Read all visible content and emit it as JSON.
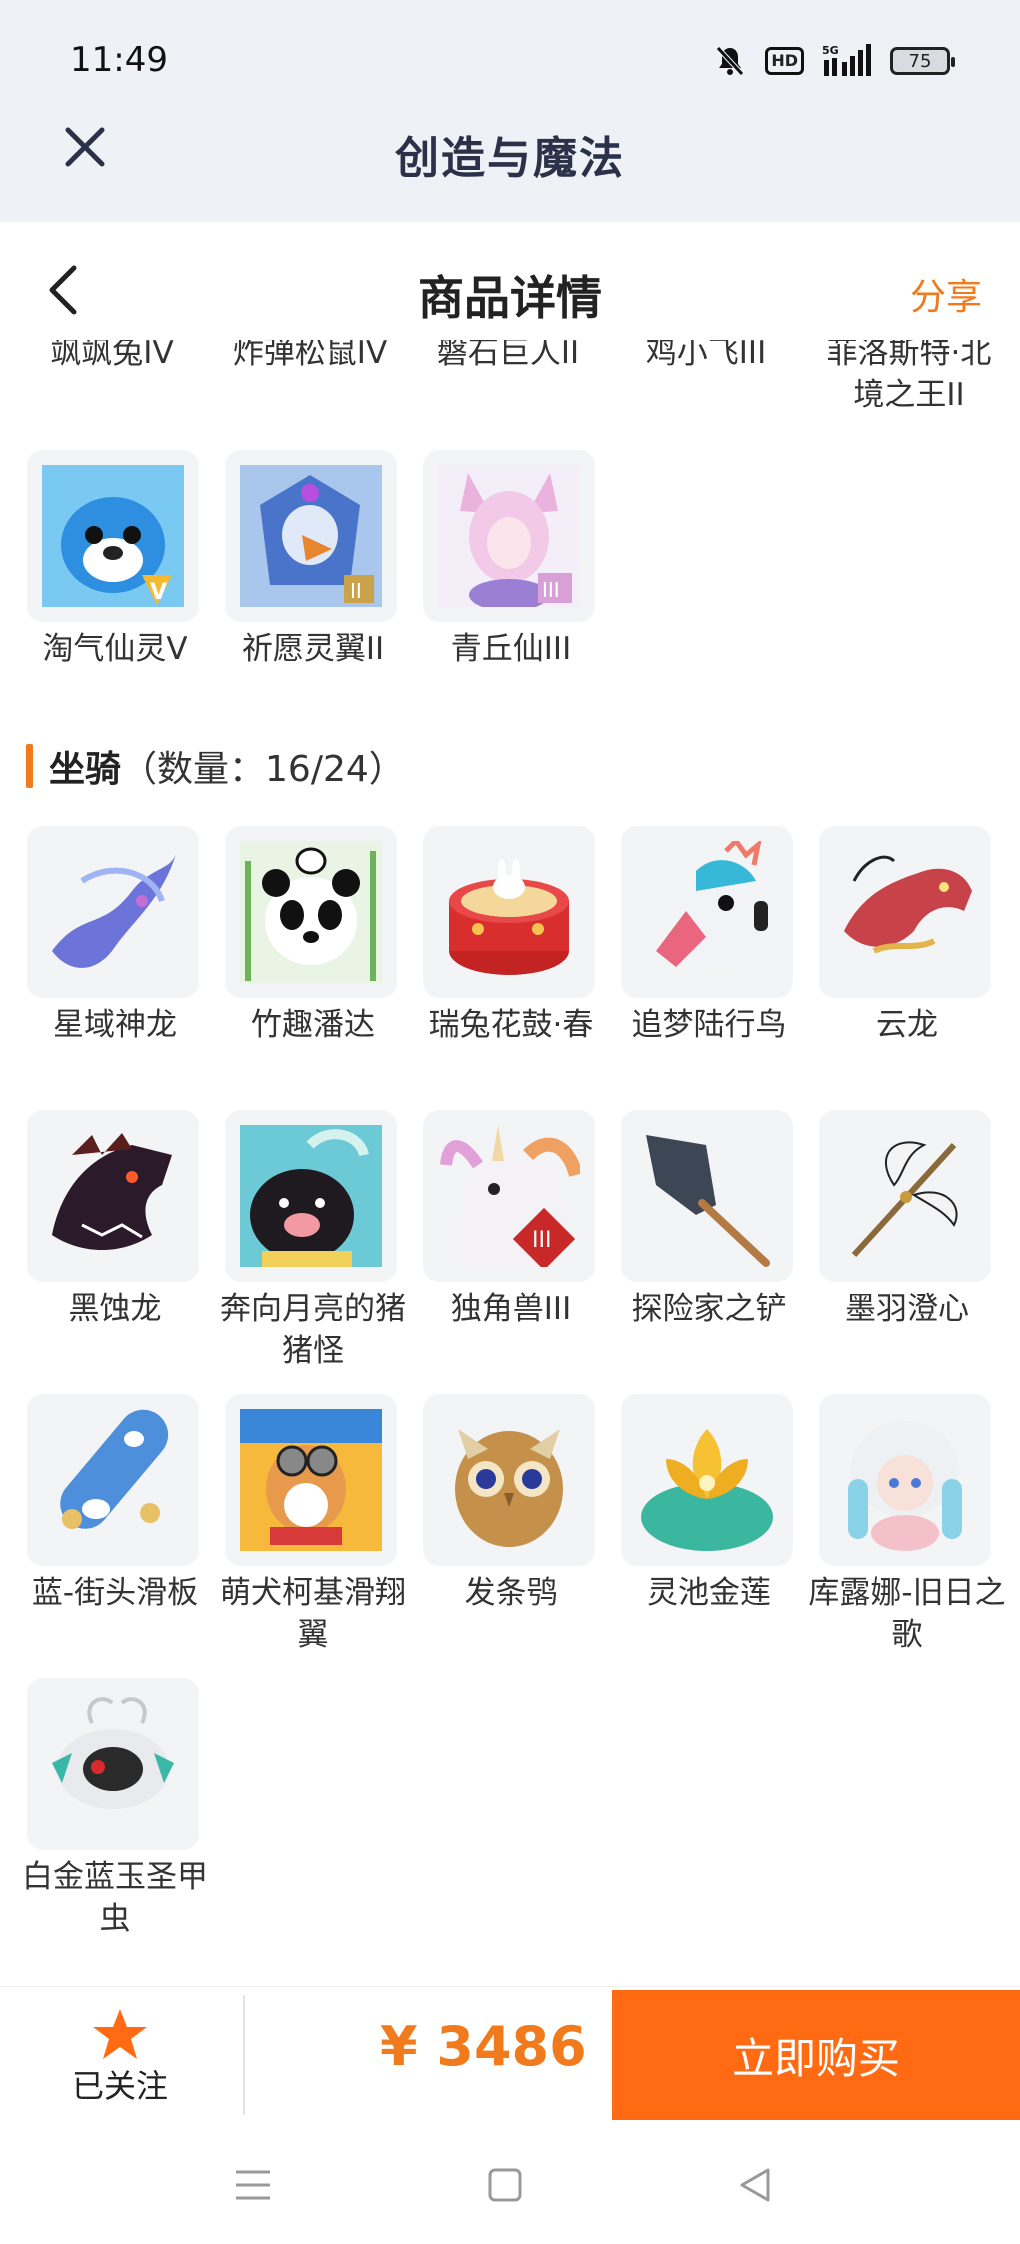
{
  "status": {
    "time": "11:49",
    "battery": "75",
    "hd": "HD",
    "network": "5G"
  },
  "miniapp": {
    "title": "创造与魔法"
  },
  "header": {
    "title": "商品详情",
    "share": "分享"
  },
  "partial_row": [
    {
      "name": "飒飒兔IV"
    },
    {
      "name": "炸弹松鼠IV"
    },
    {
      "name": "磐石巨人II"
    },
    {
      "name": "鸡小飞III"
    },
    {
      "name": "菲洛斯特·北境之王II"
    }
  ],
  "pets": [
    {
      "name": "淘气仙灵V",
      "icon": "blue-puppy-icon"
    },
    {
      "name": "祈愿灵翼II",
      "icon": "eagle-icon"
    },
    {
      "name": "青丘仙III",
      "icon": "fox-spirit-icon"
    }
  ],
  "section": {
    "name": "坐骑",
    "count": "（数量：16/24）"
  },
  "mounts": [
    {
      "name": "星域神龙",
      "icon": "star-dragon-icon"
    },
    {
      "name": "竹趣潘达",
      "icon": "panda-icon"
    },
    {
      "name": "瑞兔花鼓·春",
      "icon": "rabbit-drum-icon"
    },
    {
      "name": "追梦陆行鸟",
      "icon": "flamingo-bird-icon"
    },
    {
      "name": "云龙",
      "icon": "cloud-dragon-icon"
    },
    {
      "name": "黑蚀龙",
      "icon": "black-dragon-icon"
    },
    {
      "name": "奔向月亮的猪猪怪",
      "icon": "pig-icon"
    },
    {
      "name": "独角兽III",
      "icon": "unicorn-icon"
    },
    {
      "name": "探险家之铲",
      "icon": "shovel-icon"
    },
    {
      "name": "墨羽澄心",
      "icon": "feather-staff-icon"
    },
    {
      "name": "蓝-街头滑板",
      "icon": "skateboard-icon"
    },
    {
      "name": "萌犬柯基滑翔翼",
      "icon": "corgi-glider-icon"
    },
    {
      "name": "发条鸮",
      "icon": "clockwork-owl-icon"
    },
    {
      "name": "灵池金莲",
      "icon": "golden-lotus-icon"
    },
    {
      "name": "库露娜-旧日之歌",
      "icon": "girl-doll-icon"
    },
    {
      "name": "白金蓝玉圣甲虫",
      "icon": "scarab-icon"
    }
  ],
  "bottom": {
    "follow_label": "已关注",
    "price": "¥ 3486",
    "buy_label": "立即购买"
  },
  "colors": {
    "accent": "#f07a1c",
    "buy": "#ff6a13",
    "title": "#2b3148"
  }
}
